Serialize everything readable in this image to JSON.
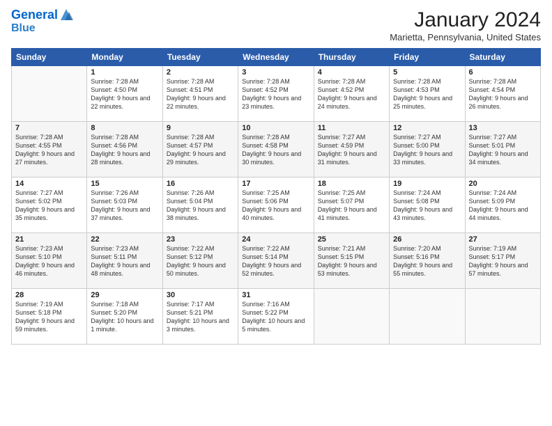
{
  "logo": {
    "line1": "General",
    "line2": "Blue"
  },
  "title": "January 2024",
  "location": "Marietta, Pennsylvania, United States",
  "days_of_week": [
    "Sunday",
    "Monday",
    "Tuesday",
    "Wednesday",
    "Thursday",
    "Friday",
    "Saturday"
  ],
  "weeks": [
    [
      {
        "num": "",
        "sunrise": "",
        "sunset": "",
        "daylight": ""
      },
      {
        "num": "1",
        "sunrise": "Sunrise: 7:28 AM",
        "sunset": "Sunset: 4:50 PM",
        "daylight": "Daylight: 9 hours and 22 minutes."
      },
      {
        "num": "2",
        "sunrise": "Sunrise: 7:28 AM",
        "sunset": "Sunset: 4:51 PM",
        "daylight": "Daylight: 9 hours and 22 minutes."
      },
      {
        "num": "3",
        "sunrise": "Sunrise: 7:28 AM",
        "sunset": "Sunset: 4:52 PM",
        "daylight": "Daylight: 9 hours and 23 minutes."
      },
      {
        "num": "4",
        "sunrise": "Sunrise: 7:28 AM",
        "sunset": "Sunset: 4:52 PM",
        "daylight": "Daylight: 9 hours and 24 minutes."
      },
      {
        "num": "5",
        "sunrise": "Sunrise: 7:28 AM",
        "sunset": "Sunset: 4:53 PM",
        "daylight": "Daylight: 9 hours and 25 minutes."
      },
      {
        "num": "6",
        "sunrise": "Sunrise: 7:28 AM",
        "sunset": "Sunset: 4:54 PM",
        "daylight": "Daylight: 9 hours and 26 minutes."
      }
    ],
    [
      {
        "num": "7",
        "sunrise": "Sunrise: 7:28 AM",
        "sunset": "Sunset: 4:55 PM",
        "daylight": "Daylight: 9 hours and 27 minutes."
      },
      {
        "num": "8",
        "sunrise": "Sunrise: 7:28 AM",
        "sunset": "Sunset: 4:56 PM",
        "daylight": "Daylight: 9 hours and 28 minutes."
      },
      {
        "num": "9",
        "sunrise": "Sunrise: 7:28 AM",
        "sunset": "Sunset: 4:57 PM",
        "daylight": "Daylight: 9 hours and 29 minutes."
      },
      {
        "num": "10",
        "sunrise": "Sunrise: 7:28 AM",
        "sunset": "Sunset: 4:58 PM",
        "daylight": "Daylight: 9 hours and 30 minutes."
      },
      {
        "num": "11",
        "sunrise": "Sunrise: 7:27 AM",
        "sunset": "Sunset: 4:59 PM",
        "daylight": "Daylight: 9 hours and 31 minutes."
      },
      {
        "num": "12",
        "sunrise": "Sunrise: 7:27 AM",
        "sunset": "Sunset: 5:00 PM",
        "daylight": "Daylight: 9 hours and 33 minutes."
      },
      {
        "num": "13",
        "sunrise": "Sunrise: 7:27 AM",
        "sunset": "Sunset: 5:01 PM",
        "daylight": "Daylight: 9 hours and 34 minutes."
      }
    ],
    [
      {
        "num": "14",
        "sunrise": "Sunrise: 7:27 AM",
        "sunset": "Sunset: 5:02 PM",
        "daylight": "Daylight: 9 hours and 35 minutes."
      },
      {
        "num": "15",
        "sunrise": "Sunrise: 7:26 AM",
        "sunset": "Sunset: 5:03 PM",
        "daylight": "Daylight: 9 hours and 37 minutes."
      },
      {
        "num": "16",
        "sunrise": "Sunrise: 7:26 AM",
        "sunset": "Sunset: 5:04 PM",
        "daylight": "Daylight: 9 hours and 38 minutes."
      },
      {
        "num": "17",
        "sunrise": "Sunrise: 7:25 AM",
        "sunset": "Sunset: 5:06 PM",
        "daylight": "Daylight: 9 hours and 40 minutes."
      },
      {
        "num": "18",
        "sunrise": "Sunrise: 7:25 AM",
        "sunset": "Sunset: 5:07 PM",
        "daylight": "Daylight: 9 hours and 41 minutes."
      },
      {
        "num": "19",
        "sunrise": "Sunrise: 7:24 AM",
        "sunset": "Sunset: 5:08 PM",
        "daylight": "Daylight: 9 hours and 43 minutes."
      },
      {
        "num": "20",
        "sunrise": "Sunrise: 7:24 AM",
        "sunset": "Sunset: 5:09 PM",
        "daylight": "Daylight: 9 hours and 44 minutes."
      }
    ],
    [
      {
        "num": "21",
        "sunrise": "Sunrise: 7:23 AM",
        "sunset": "Sunset: 5:10 PM",
        "daylight": "Daylight: 9 hours and 46 minutes."
      },
      {
        "num": "22",
        "sunrise": "Sunrise: 7:23 AM",
        "sunset": "Sunset: 5:11 PM",
        "daylight": "Daylight: 9 hours and 48 minutes."
      },
      {
        "num": "23",
        "sunrise": "Sunrise: 7:22 AM",
        "sunset": "Sunset: 5:12 PM",
        "daylight": "Daylight: 9 hours and 50 minutes."
      },
      {
        "num": "24",
        "sunrise": "Sunrise: 7:22 AM",
        "sunset": "Sunset: 5:14 PM",
        "daylight": "Daylight: 9 hours and 52 minutes."
      },
      {
        "num": "25",
        "sunrise": "Sunrise: 7:21 AM",
        "sunset": "Sunset: 5:15 PM",
        "daylight": "Daylight: 9 hours and 53 minutes."
      },
      {
        "num": "26",
        "sunrise": "Sunrise: 7:20 AM",
        "sunset": "Sunset: 5:16 PM",
        "daylight": "Daylight: 9 hours and 55 minutes."
      },
      {
        "num": "27",
        "sunrise": "Sunrise: 7:19 AM",
        "sunset": "Sunset: 5:17 PM",
        "daylight": "Daylight: 9 hours and 57 minutes."
      }
    ],
    [
      {
        "num": "28",
        "sunrise": "Sunrise: 7:19 AM",
        "sunset": "Sunset: 5:18 PM",
        "daylight": "Daylight: 9 hours and 59 minutes."
      },
      {
        "num": "29",
        "sunrise": "Sunrise: 7:18 AM",
        "sunset": "Sunset: 5:20 PM",
        "daylight": "Daylight: 10 hours and 1 minute."
      },
      {
        "num": "30",
        "sunrise": "Sunrise: 7:17 AM",
        "sunset": "Sunset: 5:21 PM",
        "daylight": "Daylight: 10 hours and 3 minutes."
      },
      {
        "num": "31",
        "sunrise": "Sunrise: 7:16 AM",
        "sunset": "Sunset: 5:22 PM",
        "daylight": "Daylight: 10 hours and 5 minutes."
      },
      {
        "num": "",
        "sunrise": "",
        "sunset": "",
        "daylight": ""
      },
      {
        "num": "",
        "sunrise": "",
        "sunset": "",
        "daylight": ""
      },
      {
        "num": "",
        "sunrise": "",
        "sunset": "",
        "daylight": ""
      }
    ]
  ]
}
